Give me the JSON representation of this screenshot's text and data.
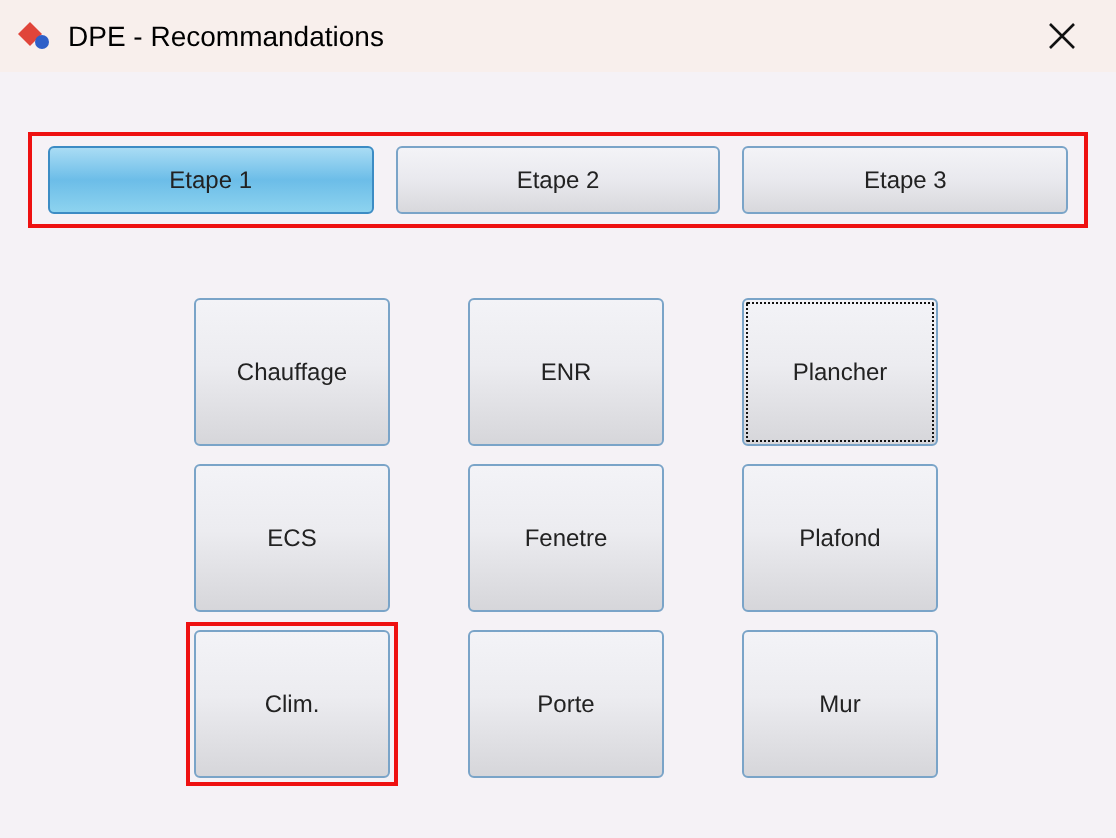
{
  "window": {
    "title": "DPE - Recommandations"
  },
  "steps": {
    "highlighted": true,
    "tabs": [
      {
        "label": "Etape 1",
        "selected": true
      },
      {
        "label": "Etape 2",
        "selected": false
      },
      {
        "label": "Etape 3",
        "selected": false
      }
    ]
  },
  "buttons": [
    {
      "label": "Chauffage",
      "focused": false,
      "highlighted": false
    },
    {
      "label": "ENR",
      "focused": false,
      "highlighted": false
    },
    {
      "label": "Plancher",
      "focused": true,
      "highlighted": false
    },
    {
      "label": "ECS",
      "focused": false,
      "highlighted": false
    },
    {
      "label": "Fenetre",
      "focused": false,
      "highlighted": false
    },
    {
      "label": "Plafond",
      "focused": false,
      "highlighted": false
    },
    {
      "label": "Clim.",
      "focused": false,
      "highlighted": true
    },
    {
      "label": "Porte",
      "focused": false,
      "highlighted": false
    },
    {
      "label": "Mur",
      "focused": false,
      "highlighted": false
    }
  ]
}
